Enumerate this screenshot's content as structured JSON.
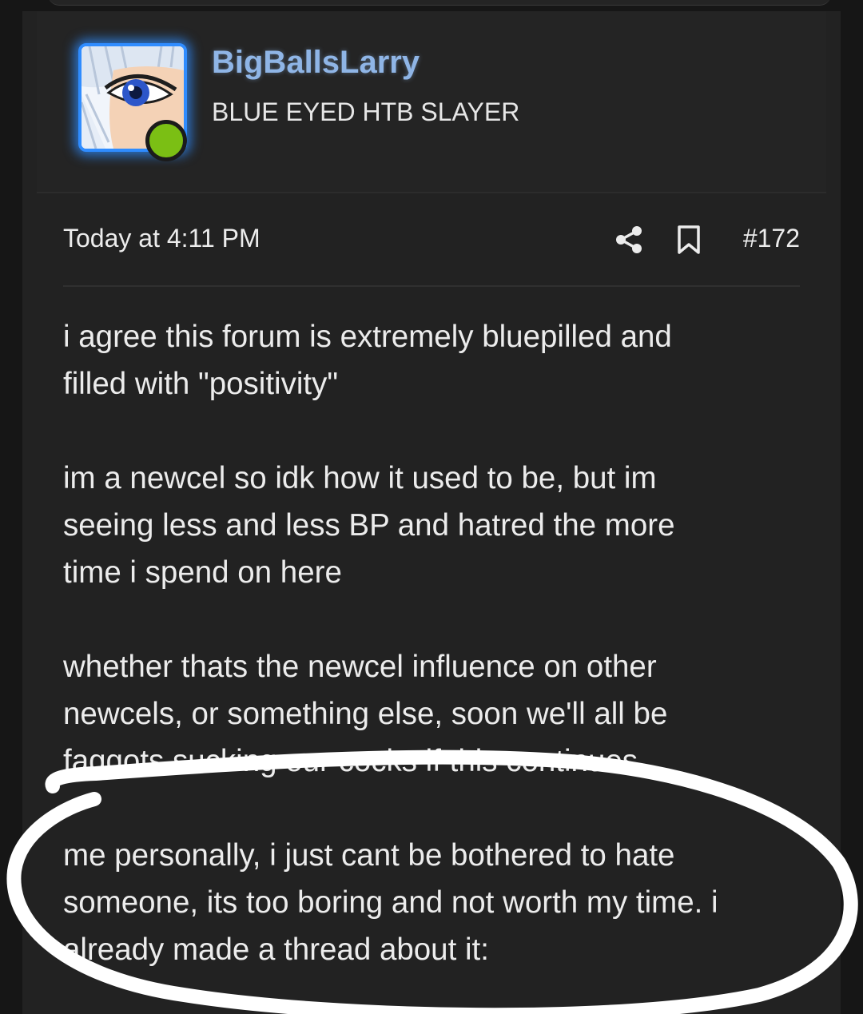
{
  "user": {
    "username": "BigBallsLarry",
    "user_title": "BLUE EYED HTB SLAYER",
    "online_status_color": "#7bbf14",
    "avatar_border_color": "#2f8cff"
  },
  "meta": {
    "timestamp": "Today at 4:11 PM",
    "post_number": "#172",
    "share_icon": "share-icon",
    "bookmark_icon": "bookmark-icon"
  },
  "body": {
    "paragraphs": [
      [
        "i agree this forum is extremely bluepilled and",
        "filled with \"positivity\""
      ],
      [
        "im a newcel so idk how it used to be, but im",
        "seeing less and less BP and hatred the more",
        "time i spend on here"
      ],
      [
        "whether thats the newcel influence on other",
        "newcels, or something else, soon we'll all be",
        "faggots sucking our cocks if this continues."
      ],
      [
        "me personally, i just cant be bothered to hate",
        "someone, its too boring and not worth my time. i",
        "already made a thread about it:"
      ]
    ]
  },
  "annotation": {
    "scribble_color": "#ffffff"
  }
}
